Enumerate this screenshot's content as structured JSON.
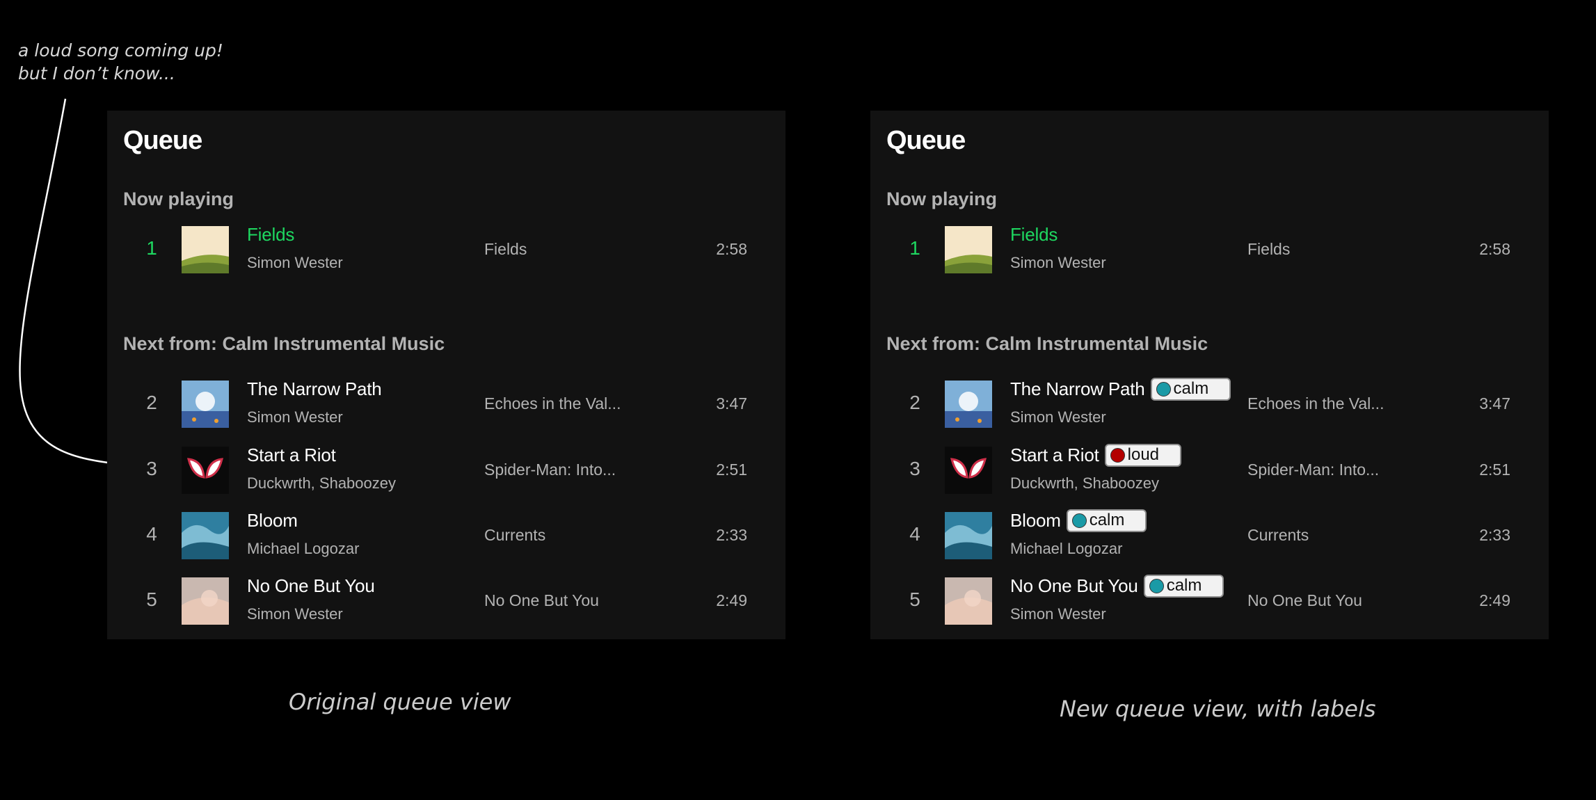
{
  "annotation": {
    "line1": "a loud song coming up!",
    "line2": "but I don’t know..."
  },
  "colors": {
    "background": "#000000",
    "panel": "#121212",
    "now_playing_green": "#1ed760",
    "muted_text": "#b3b3b3",
    "calm_dot": "#1a9aa6",
    "loud_dot": "#b30000"
  },
  "panels": [
    {
      "title": "Queue",
      "now_playing_label": "Now playing",
      "next_label": "Next from: Calm Instrumental Music",
      "caption": "Original queue view",
      "tracks": [
        {
          "num": "1",
          "title": "Fields",
          "artist": "Simon Wester",
          "album": "Fields",
          "duration": "2:58",
          "tag": null
        },
        {
          "num": "2",
          "title": "The Narrow Path",
          "artist": "Simon Wester",
          "album": "Echoes in the Val...",
          "duration": "3:47",
          "tag": null
        },
        {
          "num": "3",
          "title": "Start a Riot",
          "artist": "Duckwrth, Shaboozey",
          "album": "Spider-Man: Into...",
          "duration": "2:51",
          "tag": null
        },
        {
          "num": "4",
          "title": "Bloom",
          "artist": "Michael Logozar",
          "album": "Currents",
          "duration": "2:33",
          "tag": null
        },
        {
          "num": "5",
          "title": "No One But You",
          "artist": "Simon Wester",
          "album": "No One But You",
          "duration": "2:49",
          "tag": null
        }
      ]
    },
    {
      "title": "Queue",
      "now_playing_label": "Now playing",
      "next_label": "Next from: Calm Instrumental Music",
      "caption": "New queue view, with labels",
      "tracks": [
        {
          "num": "1",
          "title": "Fields",
          "artist": "Simon Wester",
          "album": "Fields",
          "duration": "2:58",
          "tag": null
        },
        {
          "num": "2",
          "title": "The Narrow Path",
          "artist": "Simon Wester",
          "album": "Echoes in the Val...",
          "duration": "3:47",
          "tag": "calm"
        },
        {
          "num": "3",
          "title": "Start a Riot",
          "artist": "Duckwrth, Shaboozey",
          "album": "Spider-Man: Into...",
          "duration": "2:51",
          "tag": "loud"
        },
        {
          "num": "4",
          "title": "Bloom",
          "artist": "Michael Logozar",
          "album": "Currents",
          "duration": "2:33",
          "tag": "calm"
        },
        {
          "num": "5",
          "title": "No One But You",
          "artist": "Simon Wester",
          "album": "No One But You",
          "duration": "2:49",
          "tag": "calm"
        }
      ]
    }
  ]
}
